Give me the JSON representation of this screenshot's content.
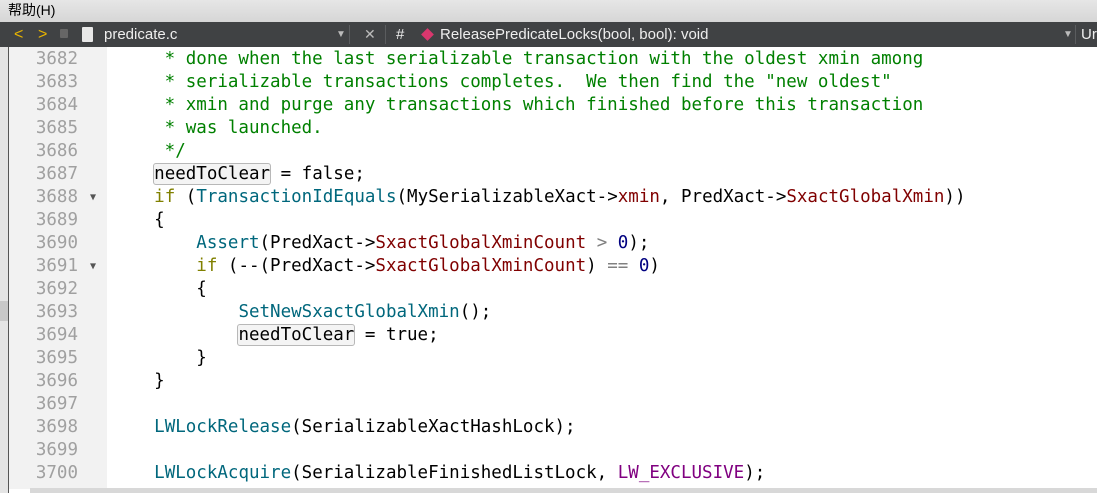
{
  "menu": {
    "help": "帮助(H)"
  },
  "toolbar": {
    "back": "<",
    "forward": ">",
    "file_name": "predicate.c",
    "hash": "#",
    "symbol": "ReleasePredicateLocks(bool, bool): void",
    "right_label": "Ur"
  },
  "colors": {
    "comment": "#008000",
    "keyword": "#808000",
    "function": "#00677c",
    "member": "#800000",
    "number": "#000080",
    "enum": "#800080"
  },
  "lines": [
    {
      "n": "3682",
      "t": [
        [
          "     * done when the last serializable transaction with the oldest xmin among",
          "c"
        ]
      ]
    },
    {
      "n": "3683",
      "t": [
        [
          "     * serializable transactions completes.  We then find the \"new oldest\"",
          "c"
        ]
      ]
    },
    {
      "n": "3684",
      "t": [
        [
          "     * xmin and purge any transactions which finished before this transaction",
          "c"
        ]
      ]
    },
    {
      "n": "3685",
      "t": [
        [
          "     * was launched.",
          "c"
        ]
      ]
    },
    {
      "n": "3686",
      "t": [
        [
          "     */",
          "c"
        ]
      ]
    },
    {
      "n": "3687",
      "t": [
        [
          "    ",
          ""
        ],
        [
          "needToClear",
          "h"
        ],
        [
          " = false;",
          ""
        ]
      ]
    },
    {
      "n": "3688",
      "fold": true,
      "t": [
        [
          "    ",
          ""
        ],
        [
          "if",
          "k"
        ],
        [
          " (",
          ""
        ],
        [
          "TransactionIdEquals",
          "f"
        ],
        [
          "(MySerializableXact->",
          ""
        ],
        [
          "xmin",
          "m"
        ],
        [
          ", PredXact->",
          ""
        ],
        [
          "SxactGlobalXmin",
          "m"
        ],
        [
          "))",
          ""
        ]
      ]
    },
    {
      "n": "3689",
      "t": [
        [
          "    {",
          ""
        ]
      ]
    },
    {
      "n": "3690",
      "t": [
        [
          "        ",
          ""
        ],
        [
          "Assert",
          "f"
        ],
        [
          "(PredXact->",
          ""
        ],
        [
          "SxactGlobalXminCount",
          "m"
        ],
        [
          " ",
          ""
        ],
        [
          ">",
          "o"
        ],
        [
          " ",
          ""
        ],
        [
          "0",
          "n"
        ],
        [
          ");",
          ""
        ]
      ]
    },
    {
      "n": "3691",
      "fold": true,
      "t": [
        [
          "        ",
          ""
        ],
        [
          "if",
          "k"
        ],
        [
          " (--(PredXact->",
          ""
        ],
        [
          "SxactGlobalXminCount",
          "m"
        ],
        [
          ") ",
          ""
        ],
        [
          "==",
          "o"
        ],
        [
          " ",
          ""
        ],
        [
          "0",
          "n"
        ],
        [
          ")",
          ""
        ]
      ]
    },
    {
      "n": "3692",
      "t": [
        [
          "        {",
          ""
        ]
      ]
    },
    {
      "n": "3693",
      "t": [
        [
          "            ",
          ""
        ],
        [
          "SetNewSxactGlobalXmin",
          "f"
        ],
        [
          "();",
          ""
        ]
      ]
    },
    {
      "n": "3694",
      "t": [
        [
          "            ",
          ""
        ],
        [
          "needToClear",
          "h"
        ],
        [
          " = true;",
          ""
        ]
      ]
    },
    {
      "n": "3695",
      "t": [
        [
          "        }",
          ""
        ]
      ]
    },
    {
      "n": "3696",
      "t": [
        [
          "    }",
          ""
        ]
      ]
    },
    {
      "n": "3697",
      "t": []
    },
    {
      "n": "3698",
      "t": [
        [
          "    ",
          ""
        ],
        [
          "LWLockRelease",
          "f"
        ],
        [
          "(SerializableXactHashLock);",
          ""
        ]
      ]
    },
    {
      "n": "3699",
      "t": []
    },
    {
      "n": "3700",
      "t": [
        [
          "    ",
          ""
        ],
        [
          "LWLockAcquire",
          "f"
        ],
        [
          "(SerializableFinishedListLock, ",
          ""
        ],
        [
          "LW_EXCLUSIVE",
          "e"
        ],
        [
          ");",
          ""
        ]
      ]
    }
  ]
}
